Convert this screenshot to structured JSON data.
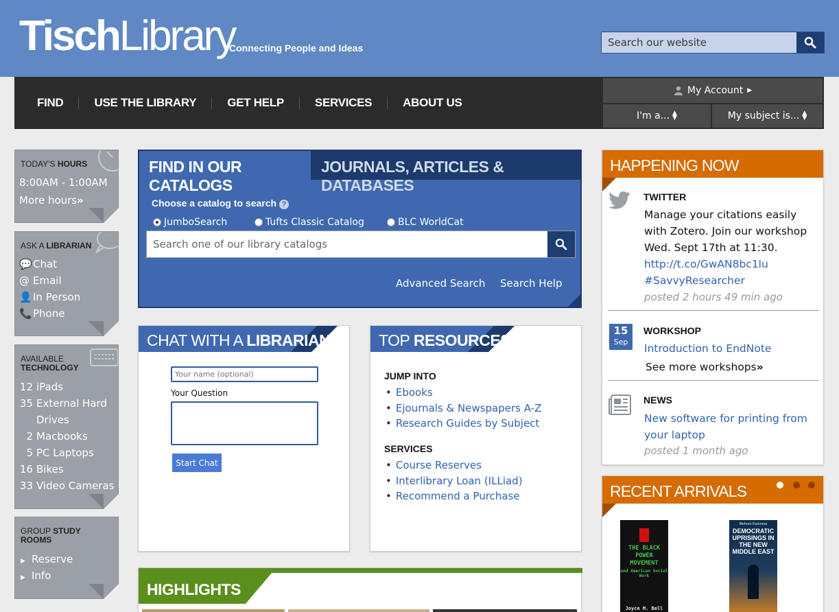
{
  "header": {
    "logo_bold": "Tisch",
    "logo_light": "Library",
    "tagline": "Connecting People and Ideas",
    "search_placeholder": "Search our website"
  },
  "nav": {
    "items": [
      "FIND",
      "USE THE LIBRARY",
      "GET HELP",
      "SERVICES",
      "ABOUT US"
    ],
    "account": "My Account",
    "im_a": "I'm a...",
    "subject": "My subject is..."
  },
  "sidebar": {
    "hours": {
      "title_light": "TODAY'S",
      "title_bold": "HOURS",
      "time": "8:00AM - 1:00AM",
      "more": "More hours"
    },
    "ask": {
      "title_light": "ASK A",
      "title_bold": "LIBRARIAN",
      "items": [
        "Chat",
        "Email",
        "In Person",
        "Phone"
      ]
    },
    "tech": {
      "title_light": "AVAILABLE",
      "title_bold": "TECHNOLOGY",
      "items": [
        {
          "count": "12",
          "name": "iPads"
        },
        {
          "count": "35",
          "name": "External Hard"
        },
        {
          "count": "",
          "name": "Drives"
        },
        {
          "count": "2",
          "name": "Macbooks"
        },
        {
          "count": "5",
          "name": "PC Laptops"
        },
        {
          "count": "16",
          "name": "Bikes"
        },
        {
          "count": "33",
          "name": "Video Cameras"
        }
      ]
    },
    "study": {
      "title_light": "GROUP",
      "title_bold": "STUDY",
      "title_bold2": "ROOMS",
      "items": [
        "Reserve",
        "Info"
      ]
    }
  },
  "catalog": {
    "tab_active": "FIND IN OUR CATALOGS",
    "tab_inactive": "JOURNALS, ARTICLES & DATABASES",
    "choose": "Choose a catalog to search",
    "options": [
      "JumboSearch",
      "Tufts Classic Catalog",
      "BLC WorldCat"
    ],
    "selected": "JumboSearch",
    "placeholder": "Search one of our library catalogs",
    "advanced": "Advanced Search",
    "help": "Search Help"
  },
  "chat": {
    "title_light": "CHAT WITH A",
    "title_bold": "LIBRARIAN",
    "name_placeholder": "Your name (optional)",
    "question_label": "Your Question",
    "button": "Start Chat"
  },
  "resources": {
    "title_light": "TOP",
    "title_bold": "RESOURCES",
    "jump_head": "JUMP INTO",
    "jump": [
      "Ebooks",
      "Ejournals & Newspapers A-Z",
      "Research Guides by Subject"
    ],
    "services_head": "SERVICES",
    "services": [
      "Course Reserves",
      "Interlibrary Loan (ILLiad)",
      "Recommend a Purchase"
    ]
  },
  "highlights": {
    "title": "HIGHLIGHTS"
  },
  "happening": {
    "title": "HAPPENING NOW",
    "twitter": {
      "type": "TWITTER",
      "text": "Manage your citations easily with Zotero. Join our workshop Wed. Sept 17th at 11:30.",
      "link": "http://t.co/GwAN8bc1lu",
      "tag": "#SavvyResearcher",
      "meta": "posted 2 hours 49 min ago"
    },
    "workshop": {
      "type": "WORKSHOP",
      "day": "15",
      "month": "Sep",
      "link": "Introduction to EndNote",
      "more": "See more workshops"
    },
    "news": {
      "type": "NEWS",
      "link": "New software for printing from your laptop",
      "meta": "posted 1 month ago"
    }
  },
  "recent": {
    "title": "RECENT ARRIVALS",
    "book1": {
      "title": "THE BLACK POWER MOVEMENT",
      "subtitle": "and American Social Work",
      "author": "Joyce M. Bell"
    },
    "book2": {
      "title": "DEMOCRATIC UPRISINGS IN THE NEW MIDDLE EAST",
      "author": "Mehran Kamrava"
    }
  },
  "colors": {
    "header_blue": "#5f88c4",
    "nav_dark": "#2b2b2b",
    "catalog_blue": "#3f68b0",
    "navy": "#1c3a6b",
    "orange": "#d66b00",
    "green": "#5a8f1c",
    "link": "#2e62b0"
  }
}
